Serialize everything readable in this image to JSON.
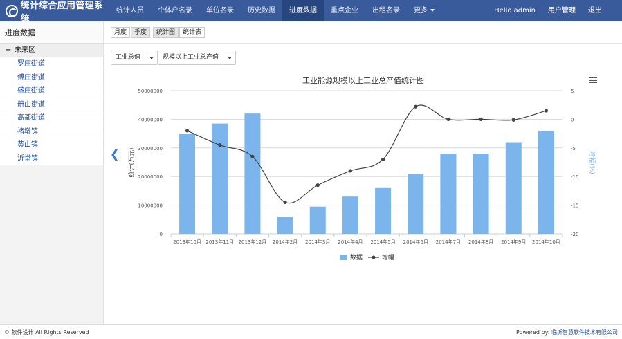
{
  "app": {
    "title": "统计综合应用管理系统"
  },
  "nav": {
    "items": [
      "统计人员",
      "个体户名录",
      "单位名录",
      "历史数据",
      "进度数据",
      "重点企业",
      "出租名录",
      "更多"
    ],
    "active_index": 4,
    "right": {
      "greeting": "Hello admin",
      "user_mgmt": "用户管理",
      "logout": "退出"
    }
  },
  "sidebar": {
    "title": "进度数据",
    "root": "未来区",
    "items": [
      "罗庄街道",
      "傅庄街道",
      "盛庄街道",
      "册山街道",
      "高都街道",
      "褚墩镇",
      "黄山镇",
      "沂堂镇"
    ]
  },
  "tabs": {
    "month": "月度",
    "quarter": "季度",
    "chart": "统计图",
    "table": "统计表"
  },
  "filters": {
    "category": "工业总值",
    "indicator": "规模以上工业总产值"
  },
  "chart_data": {
    "type": "bar+line",
    "title": "工业能源规模以上工业总产值统计图",
    "categories": [
      "2013年10月",
      "2013年11月",
      "2013年12月",
      "2014年2月",
      "2014年3月",
      "2014年4月",
      "2014年5月",
      "2014年6月",
      "2014年7月",
      "2014年8月",
      "2014年9月",
      "2014年10月"
    ],
    "series": [
      {
        "name": "数据",
        "type": "bar",
        "axis": "left",
        "color": "#7cb5ec",
        "values": [
          35000000,
          38500000,
          42000000,
          6000000,
          9500000,
          13000000,
          16000000,
          21000000,
          28000000,
          28000000,
          32000000,
          36000000
        ]
      },
      {
        "name": "增幅",
        "type": "line",
        "axis": "right",
        "color": "#434348",
        "values": [
          -2,
          -4.5,
          -6.5,
          -14.5,
          -11.5,
          -9,
          -7,
          2.2,
          0,
          0,
          -0.1,
          1.5
        ]
      }
    ],
    "ylabel_left": "统计(万元)",
    "ylabel_right": "增幅(%)",
    "yticks_left": [
      "50000000",
      "40000000",
      "30000000",
      "20000000",
      "10000000",
      "0"
    ],
    "yticks_right": [
      "5",
      "0",
      "-5",
      "-10",
      "-15",
      "-20"
    ],
    "ylim_left": [
      0,
      50000000
    ],
    "ylim_right": [
      -20,
      5
    ],
    "legend": "bottom-center"
  },
  "footer": {
    "left": "© 软件设计 All Rights Reserved",
    "right_prefix": "Powered by:",
    "right_company": "临沂智慧软件技术有限公司"
  }
}
